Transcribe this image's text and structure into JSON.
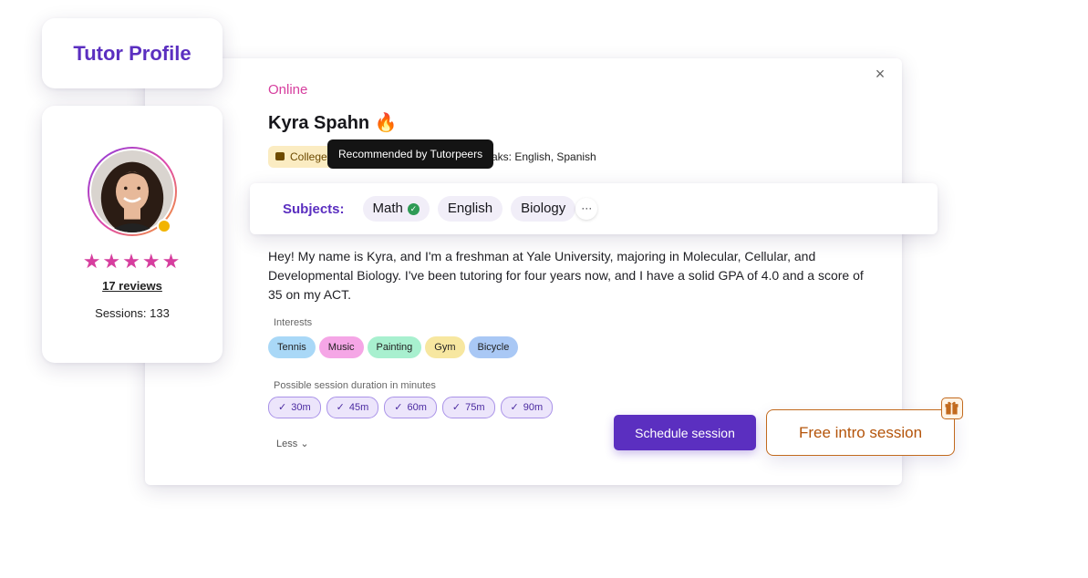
{
  "title_card": {
    "title": "Tutor Profile"
  },
  "profile": {
    "stars": "★★★★★",
    "rating": 5,
    "reviews": "17 reviews",
    "sessions": "Sessions: 133"
  },
  "main": {
    "close": "×",
    "status": "Online",
    "name": "Kyra Spahn",
    "name_emoji": "🔥",
    "college_badge": "College",
    "tooltip": "Recommended by Tutorpeers",
    "speaks": "aks: English, Spanish",
    "bio": "Hey! My name is Kyra, and I'm a freshman at Yale University, majoring in Molecular, Cellular, and Developmental Biology. I've been tutoring for four years now, and I have a solid GPA of 4.0 and a score of 35 on my ACT.",
    "interests_label": "Interests",
    "interests": [
      {
        "label": "Tennis",
        "color": "#a9d8f7"
      },
      {
        "label": "Music",
        "color": "#f5a6e6"
      },
      {
        "label": "Painting",
        "color": "#a8f0cf"
      },
      {
        "label": "Gym",
        "color": "#f7e7a0"
      },
      {
        "label": "Bicycle",
        "color": "#a9c8f5"
      }
    ],
    "duration_label": "Possible session duration in minutes",
    "durations": [
      "30m",
      "45m",
      "60m",
      "75m",
      "90m"
    ],
    "less": "Less"
  },
  "subjects": {
    "label": "Subjects:",
    "items": [
      "Math",
      "English",
      "Biology"
    ],
    "more": "···"
  },
  "actions": {
    "schedule": "Schedule session",
    "free_intro": "Free intro session"
  },
  "colors": {
    "brand": "#5b2fc0",
    "accent_pink": "#d63e9e",
    "intro_orange": "#b4540a"
  }
}
